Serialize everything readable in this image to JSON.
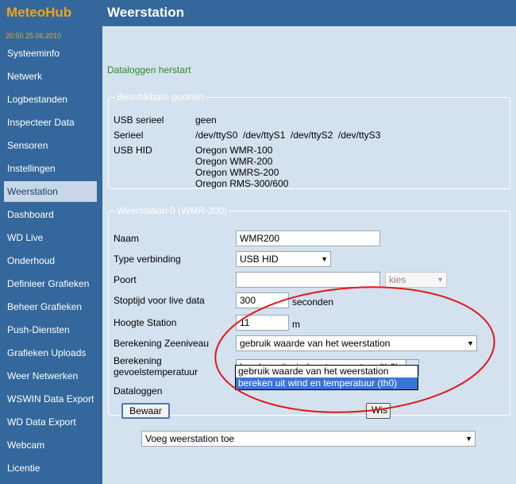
{
  "sidebar": {
    "brand": "MeteoHub",
    "clock": "20:50   25.06.2010",
    "items": [
      {
        "label": "Systeeminfo"
      },
      {
        "label": "Netwerk"
      },
      {
        "label": "Logbestanden"
      },
      {
        "label": "Inspecteer Data"
      },
      {
        "label": "Sensoren"
      },
      {
        "label": "Instellingen"
      },
      {
        "label": "Weerstation",
        "active": true
      },
      {
        "label": "Dashboard"
      },
      {
        "label": "WD Live"
      },
      {
        "label": "Onderhoud"
      },
      {
        "label": "Definieer Grafieken"
      },
      {
        "label": "Beheer Grafieken"
      },
      {
        "label": "Push-Diensten"
      },
      {
        "label": "Grafieken Uploads"
      },
      {
        "label": "Weer Netwerken"
      },
      {
        "label": "WSWIN Data Export"
      },
      {
        "label": "WD Data Export"
      },
      {
        "label": "Webcam"
      },
      {
        "label": "Licentie"
      }
    ]
  },
  "header": {
    "title": "Weerstation"
  },
  "status_message": "Dataloggen herstart",
  "ports": {
    "legend": "Beschikbare poorten",
    "usb_serial_label": "USB serieel",
    "usb_serial_value": "geen",
    "serial_label": "Serieel",
    "serial_values": [
      "/dev/ttyS0",
      "/dev/ttyS1",
      "/dev/ttyS2",
      "/dev/ttyS3"
    ],
    "usb_hid_label": "USB HID",
    "usb_hid_values": [
      "Oregon WMR-100",
      "Oregon WMR-200",
      "Oregon WMRS-200",
      "Oregon RMS-300/600"
    ]
  },
  "station": {
    "legend": "Weerstation 0 (WMR-200)",
    "name_label": "Naam",
    "name_value": "WMR200",
    "connection_label": "Type verbinding",
    "connection_value": "USB HID",
    "port_label": "Poort",
    "port_value": "",
    "port_picker": "kies",
    "stop_label": "Stoptijd voor live data",
    "stop_value": "300",
    "stop_unit": "seconden",
    "height_label": "Hoogte Station",
    "height_value": "11",
    "height_unit": "m",
    "sealevel_label": "Berekening Zeeniveau",
    "sealevel_value": "gebruik waarde van het weerstation",
    "feels_label_line1": "Berekening",
    "feels_label_line2": "gevoelstemperatuur",
    "feels_value": "bereken uit wind en temperatuur (th0)",
    "feels_options": [
      "gebruik waarde van het weerstation",
      "bereken uit wind en temperatuur (th0)"
    ],
    "logger_label": "Dataloggen",
    "save_button": "Bewaar",
    "delete_button": "Wis"
  },
  "add_station": {
    "value": "Voeg weerstation toe"
  },
  "colors": {
    "sidebar_bg": "#34689c",
    "brand": "#f3a11c",
    "main_bg": "#d4e1ee",
    "status": "#2a8b2a",
    "annotation": "#e01818",
    "selection": "#3875d7"
  }
}
